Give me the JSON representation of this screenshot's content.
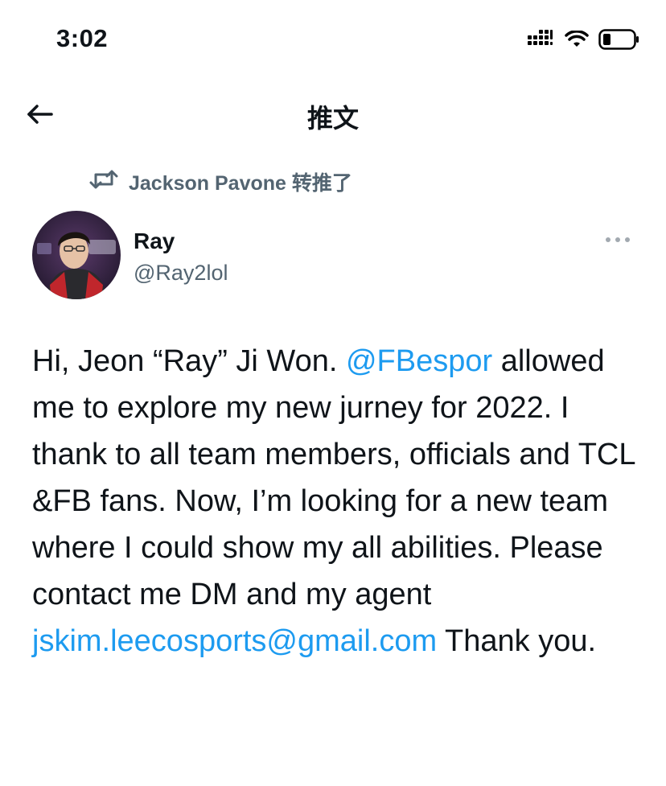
{
  "status_bar": {
    "time": "3:02"
  },
  "nav": {
    "title": "推文"
  },
  "retweet_context": {
    "text": "Jackson Pavone 转推了"
  },
  "author": {
    "name": "Ray",
    "handle": "@Ray2lol"
  },
  "tweet": {
    "t1": "Hi, Jeon “Ray” Ji Won. ",
    "mention": "@FBespor",
    "t2": " allowed me to explore my new jurney for 2022. I thank to all team members, officials and TCL &FB fans. Now, I’m looking for a new team where I could show my all abilities. Please contact me DM and my agent ",
    "email": "jskim.leecosports@gmail.com",
    "t3": " Thank you."
  },
  "colors": {
    "accent": "#1d9bf0",
    "text": "#0f1419",
    "secondary": "#536471"
  },
  "icons": [
    "back-arrow-icon",
    "retweet-icon",
    "more-icon",
    "signal-icon",
    "wifi-icon",
    "battery-icon"
  ]
}
